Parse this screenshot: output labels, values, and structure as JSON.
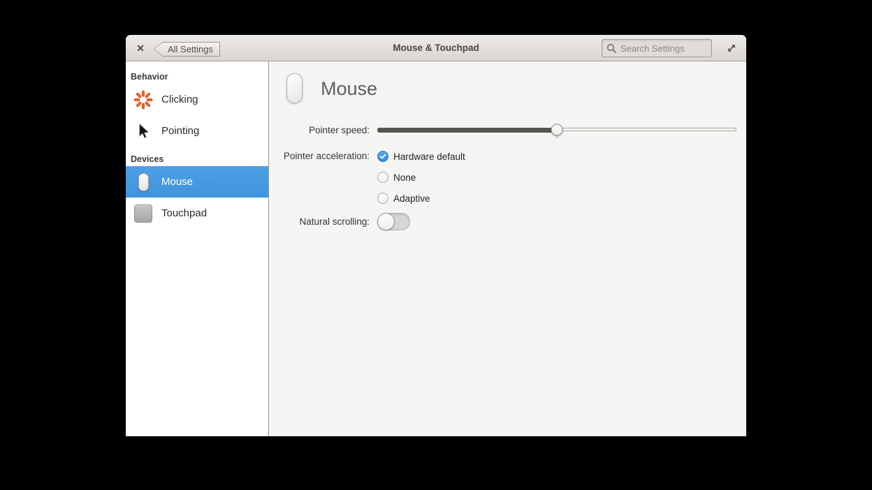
{
  "titlebar": {
    "close_label": "✕",
    "back_label": "All Settings",
    "title": "Mouse & Touchpad",
    "search_placeholder": "Search Settings"
  },
  "sidebar": {
    "sections": [
      {
        "header": "Behavior",
        "items": [
          {
            "label": "Clicking",
            "icon": "starburst-icon",
            "selected": false
          },
          {
            "label": "Pointing",
            "icon": "cursor-icon",
            "selected": false
          }
        ]
      },
      {
        "header": "Devices",
        "items": [
          {
            "label": "Mouse",
            "icon": "mouse-icon",
            "selected": true
          },
          {
            "label": "Touchpad",
            "icon": "touchpad-icon",
            "selected": false
          }
        ]
      }
    ]
  },
  "content": {
    "title": "Mouse",
    "rows": {
      "pointer_speed": {
        "label": "Pointer speed:",
        "value_percent": 50
      },
      "pointer_acceleration": {
        "label": "Pointer acceleration:",
        "options": [
          {
            "label": "Hardware default",
            "selected": true
          },
          {
            "label": "None",
            "selected": false
          },
          {
            "label": "Adaptive",
            "selected": false
          }
        ]
      },
      "natural_scrolling": {
        "label": "Natural scrolling:",
        "enabled": false
      }
    }
  },
  "colors": {
    "selection_blue": "#459ce2",
    "radio_checked_blue": "#3d97e2",
    "clicking_icon_orange": "#e0632d",
    "content_background": "#f5f5f4",
    "sidebar_background": "#ffffff",
    "titlebar_top": "#eeecea",
    "titlebar_bottom": "#d9d5d1",
    "desktop_background": "#000000"
  }
}
